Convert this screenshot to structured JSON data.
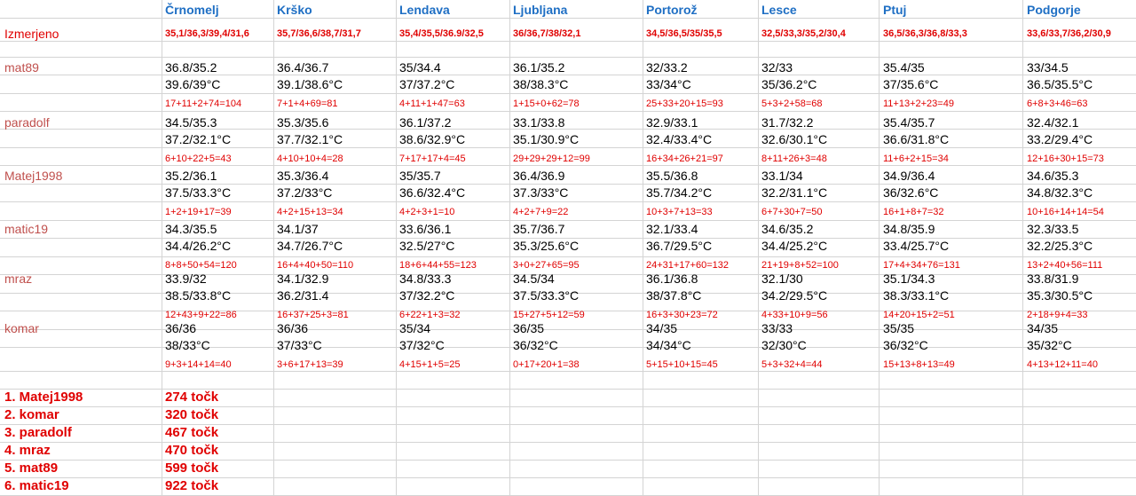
{
  "cities": [
    "Črnomelj",
    "Krško",
    "Lendava",
    "Ljubljana",
    "Portorož",
    "Lesce",
    "Ptuj",
    "Podgorje"
  ],
  "measured": {
    "label": "Izmerjeno",
    "values": [
      "35,1/36,3/39,4/31,6",
      "35,7/36,6/38,7/31,7",
      "35,4/35,5/36.9/32,5",
      "36/36,7/38/32,1",
      "34,5/36,5/35/35,5",
      "32,5/33,3/35,2/30,4",
      "36,5/36,3/36,8/33,3",
      "33,6/33,7/36,2/30,9"
    ]
  },
  "participants": [
    {
      "name": "mat89",
      "line1": [
        "36.8/35.2",
        "36.4/36.7",
        "35/34.4",
        "36.1/35.2",
        "32/33.2",
        "32/33",
        "35.4/35",
        "33/34.5"
      ],
      "line2": [
        "39.6/39°C",
        "39.1/38.6°C",
        "37/37.2°C",
        "38/38.3°C",
        "33/34°C",
        "35/36.2°C",
        "37/35.6°C",
        "36.5/35.5°C"
      ],
      "scores": [
        "17+11+2+74=104",
        "7+1+4+69=81",
        "4+11+1+47=63",
        "1+15+0+62=78",
        "25+33+20+15=93",
        "5+3+2+58=68",
        "11+13+2+23=49",
        "6+8+3+46=63"
      ]
    },
    {
      "name": "paradolf",
      "line1": [
        "34.5/35.3",
        "35.3/35.6",
        "36.1/37.2",
        "33.1/33.8",
        "32.9/33.1",
        "31.7/32.2",
        "35.4/35.7",
        "32.4/32.1"
      ],
      "line2": [
        "37.2/32.1°C",
        "37.7/32.1°C",
        "38.6/32.9°C",
        "35.1/30.9°C",
        "32.4/33.4°C",
        "32.6/30.1°C",
        "36.6/31.8°C",
        "33.2/29.4°C"
      ],
      "scores": [
        "6+10+22+5=43",
        "4+10+10+4=28",
        "7+17+17+4=45",
        "29+29+29+12=99",
        "16+34+26+21=97",
        "8+11+26+3=48",
        "11+6+2+15=34",
        "12+16+30+15=73"
      ]
    },
    {
      "name": "Matej1998",
      "line1": [
        "35.2/36.1",
        "35.3/36.4",
        "35/35.7",
        "36.4/36.9",
        "35.5/36.8",
        "33.1/34",
        "34.9/36.4",
        "34.6/35.3"
      ],
      "line2": [
        "37.5/33.3°C",
        "37.2/33°C",
        "36.6/32.4°C",
        "37.3/33°C",
        "35.7/34.2°C",
        "32.2/31.1°C",
        "36/32.6°C",
        "34.8/32.3°C"
      ],
      "scores": [
        "1+2+19+17=39",
        "4+2+15+13=34",
        "4+2+3+1=10",
        "4+2+7+9=22",
        "10+3+7+13=33",
        "6+7+30+7=50",
        "16+1+8+7=32",
        "10+16+14+14=54"
      ]
    },
    {
      "name": "matic19",
      "line1": [
        "34.3/35.5",
        "34.1/37",
        "33.6/36.1",
        "35.7/36.7",
        "32.1/33.4",
        "34.6/35.2",
        "34.8/35.9",
        "32.3/33.5"
      ],
      "line2": [
        "34.4/26.2°C",
        "34.7/26.7°C",
        "32.5/27°C",
        "35.3/25.6°C",
        "36.7/29.5°C",
        "34.4/25.2°C",
        "33.4/25.7°C",
        "32.2/25.3°C"
      ],
      "scores": [
        "8+8+50+54=120",
        "16+4+40+50=110",
        "18+6+44+55=123",
        "3+0+27+65=95",
        "24+31+17+60=132",
        "21+19+8+52=100",
        "17+4+34+76=131",
        "13+2+40+56=111"
      ]
    },
    {
      "name": "mraz",
      "line1": [
        "33.9/32",
        "34.1/32.9",
        "34.8/33.3",
        "34.5/34",
        "36.1/36.8",
        "32.1/30",
        "35.1/34.3",
        "33.8/31.9"
      ],
      "line2": [
        "38.5/33.8°C",
        "36.2/31.4",
        "37/32.2°C",
        "37.5/33.3°C",
        "38/37.8°C",
        "34.2/29.5°C",
        "38.3/33.1°C",
        "35.3/30.5°C"
      ],
      "scores": [
        "12+43+9+22=86",
        "16+37+25+3=81",
        "6+22+1+3=32",
        "15+27+5+12=59",
        "16+3+30+23=72",
        "4+33+10+9=56",
        "14+20+15+2=51",
        "2+18+9+4=33"
      ]
    },
    {
      "name": "komar",
      "line1": [
        "36/36",
        "36/36",
        "35/34",
        "36/35",
        "34/35",
        "33/33",
        "35/35",
        "34/35"
      ],
      "line2": [
        "38/33°C",
        "37/33°C",
        "37/32°C",
        "36/32°C",
        "34/34°C",
        "32/30°C",
        "36/32°C",
        "35/32°C"
      ],
      "scores": [
        "9+3+14+14=40",
        "3+6+17+13=39",
        "4+15+1+5=25",
        "0+17+20+1=38",
        "5+15+10+15=45",
        "5+3+32+4=44",
        "15+13+8+13=49",
        "4+13+12+11=40"
      ]
    }
  ],
  "ranking": [
    {
      "place": "1. Matej1998",
      "points": "274 točk"
    },
    {
      "place": "2. komar",
      "points": "320 točk"
    },
    {
      "place": "3. paradolf",
      "points": "467 točk"
    },
    {
      "place": "4. mraz",
      "points": "470 točk"
    },
    {
      "place": "5. mat89",
      "points": "599 točk"
    },
    {
      "place": "6. matic19",
      "points": "922 točk"
    }
  ]
}
